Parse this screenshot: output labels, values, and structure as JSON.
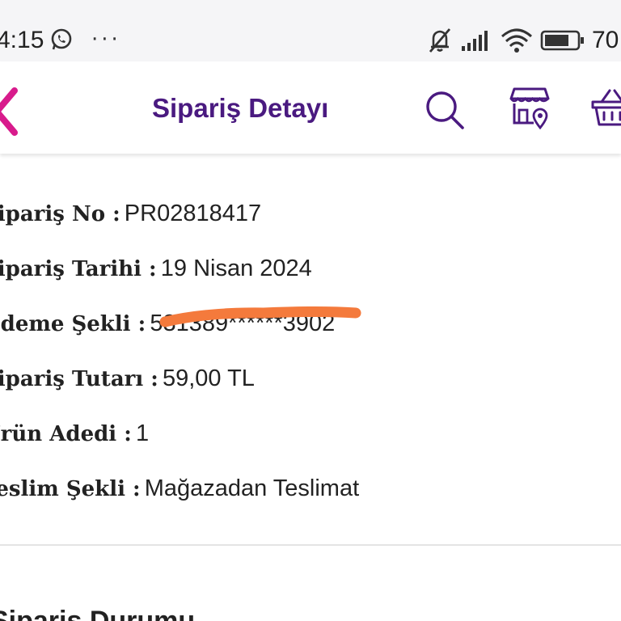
{
  "status_bar": {
    "time": "4:15",
    "dots": "···",
    "battery_percent": "70"
  },
  "header": {
    "title": "Sipariş Detayı",
    "back_icon": "chevron-left-icon",
    "search_icon": "search-icon",
    "store_icon": "store-location-icon",
    "basket_icon": "basket-icon"
  },
  "order": {
    "rows": [
      {
        "label": "Sipariş No :",
        "value": "PR02818417"
      },
      {
        "label": "Sipariş Tarihi :",
        "value": "19 Nisan 2024"
      },
      {
        "label": "Ödeme Şekli :",
        "value": "531389******3902"
      },
      {
        "label": "Sipariş Tutarı :",
        "value": "59,00 TL"
      },
      {
        "label": "Ürün Adedi :",
        "value": "1"
      },
      {
        "label": "Teslim Şekli :",
        "value": "Mağazadan Teslimat"
      }
    ]
  },
  "status_section": {
    "title": "Sipariş Durumu"
  },
  "colors": {
    "brand_purple": "#4a1a80",
    "back_pink": "#d81b8c",
    "redaction_orange": "#f47a3c"
  }
}
